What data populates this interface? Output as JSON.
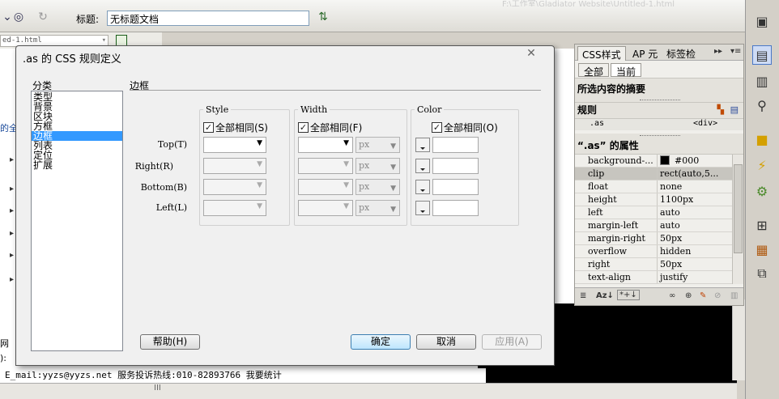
{
  "app": {
    "window_title": "F:\\工作室\\Gladiator Website\\Untitled-1.html",
    "page_title_label": "标题:",
    "page_title_value": "无标题文档",
    "file_tab": "ed-1.html",
    "status_text": "E_mail:yyzs@yyzs.net 服务投诉热线:010-82893766 我要统计",
    "bg_fragments": [
      "的全",
      "网",
      "):"
    ],
    "scroll_marker": "III"
  },
  "dialog": {
    "title": ".as 的 CSS 规则定义",
    "category_label": "分类",
    "categories": [
      "类型",
      "背景",
      "区块",
      "方框",
      "边框",
      "列表",
      "定位",
      "扩展"
    ],
    "selected_category_index": 4,
    "section_title": "边框",
    "groups": {
      "style": {
        "legend": "Style",
        "same_label": "全部相同(S)",
        "checked": true
      },
      "width": {
        "legend": "Width",
        "same_label": "全部相同(F)",
        "checked": true
      },
      "color": {
        "legend": "Color",
        "same_label": "全部相同(O)",
        "checked": true
      }
    },
    "rows": [
      {
        "label": "Top(T)",
        "unit": "px"
      },
      {
        "label": "Right(R)",
        "unit": "px"
      },
      {
        "label": "Bottom(B)",
        "unit": "px"
      },
      {
        "label": "Left(L)",
        "unit": "px"
      }
    ],
    "buttons": {
      "help": "帮助(H)",
      "ok": "确定",
      "cancel": "取消",
      "apply": "应用(A)"
    }
  },
  "css_panel": {
    "tabs": [
      "CSS样式",
      "AP 元",
      "标签检"
    ],
    "modes": [
      "全部",
      "当前"
    ],
    "summary_title": "所选内容的摘要",
    "rules_title": "规则",
    "rule": {
      "selector": ".as",
      "element": "<div>"
    },
    "props_title": "“.as” 的属性",
    "properties": [
      {
        "name": "background-...",
        "value": "#000",
        "swatch": "#000000"
      },
      {
        "name": "clip",
        "value": "rect(auto,5...",
        "selected": true
      },
      {
        "name": "float",
        "value": "none"
      },
      {
        "name": "height",
        "value": "1100px"
      },
      {
        "name": "left",
        "value": "auto"
      },
      {
        "name": "margin-left",
        "value": "auto"
      },
      {
        "name": "margin-right",
        "value": "50px"
      },
      {
        "name": "overflow",
        "value": "hidden"
      },
      {
        "name": "right",
        "value": "50px"
      },
      {
        "name": "text-align",
        "value": "justify"
      }
    ],
    "footer_icons": [
      "list-view-icon",
      "sort-az-icon",
      "show-set-icon",
      "attach-icon",
      "new-rule-icon",
      "edit-icon",
      "disable-icon",
      "delete-icon"
    ]
  }
}
